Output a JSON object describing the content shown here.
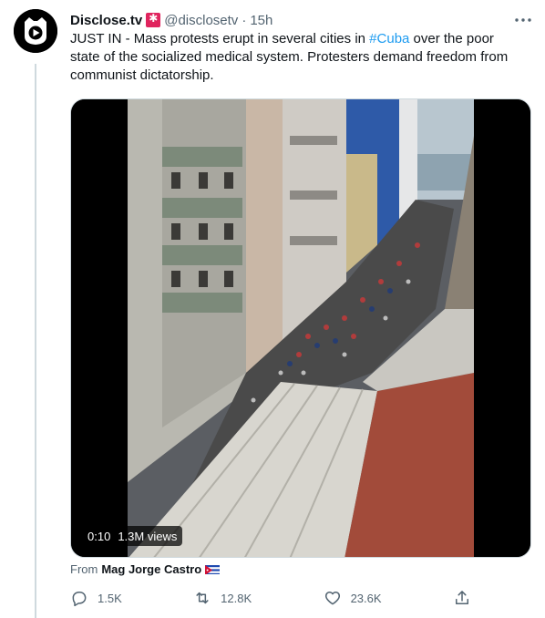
{
  "tweet": {
    "display_name": "Disclose.tv",
    "handle": "@disclosetv",
    "separator": "·",
    "time": "15h",
    "text_before": "JUST IN - Mass protests erupt in several cities in ",
    "hashtag": "#Cuba",
    "text_after": " over the poor state of the socialized medical system. Protesters demand freedom from communist dictatorship."
  },
  "media": {
    "duration": "0:10",
    "views": "1.3M views"
  },
  "attribution": {
    "prefix": "From",
    "name": "Mag Jorge Castro"
  },
  "actions": {
    "replies": "1.5K",
    "retweets": "12.8K",
    "likes": "23.6K"
  },
  "colors": {
    "accent": "#1d9bf0",
    "secondary_text": "#536471",
    "badge": "#e0245e"
  },
  "icons": [
    "logo-avatar-icon",
    "siren-badge-icon",
    "more-icon",
    "reply-icon",
    "retweet-icon",
    "like-icon",
    "share-icon",
    "cuba-flag-icon"
  ]
}
